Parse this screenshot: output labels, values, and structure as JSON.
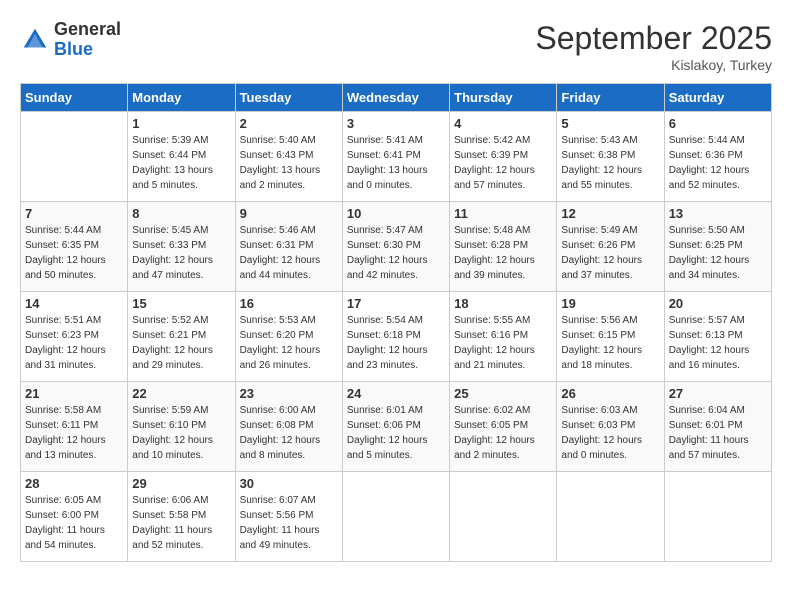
{
  "header": {
    "logo_general": "General",
    "logo_blue": "Blue",
    "title": "September 2025",
    "location": "Kislakoy, Turkey"
  },
  "days_of_week": [
    "Sunday",
    "Monday",
    "Tuesday",
    "Wednesday",
    "Thursday",
    "Friday",
    "Saturday"
  ],
  "weeks": [
    [
      {
        "day": "",
        "info": ""
      },
      {
        "day": "1",
        "info": "Sunrise: 5:39 AM\nSunset: 6:44 PM\nDaylight: 13 hours\nand 5 minutes."
      },
      {
        "day": "2",
        "info": "Sunrise: 5:40 AM\nSunset: 6:43 PM\nDaylight: 13 hours\nand 2 minutes."
      },
      {
        "day": "3",
        "info": "Sunrise: 5:41 AM\nSunset: 6:41 PM\nDaylight: 13 hours\nand 0 minutes."
      },
      {
        "day": "4",
        "info": "Sunrise: 5:42 AM\nSunset: 6:39 PM\nDaylight: 12 hours\nand 57 minutes."
      },
      {
        "day": "5",
        "info": "Sunrise: 5:43 AM\nSunset: 6:38 PM\nDaylight: 12 hours\nand 55 minutes."
      },
      {
        "day": "6",
        "info": "Sunrise: 5:44 AM\nSunset: 6:36 PM\nDaylight: 12 hours\nand 52 minutes."
      }
    ],
    [
      {
        "day": "7",
        "info": "Sunrise: 5:44 AM\nSunset: 6:35 PM\nDaylight: 12 hours\nand 50 minutes."
      },
      {
        "day": "8",
        "info": "Sunrise: 5:45 AM\nSunset: 6:33 PM\nDaylight: 12 hours\nand 47 minutes."
      },
      {
        "day": "9",
        "info": "Sunrise: 5:46 AM\nSunset: 6:31 PM\nDaylight: 12 hours\nand 44 minutes."
      },
      {
        "day": "10",
        "info": "Sunrise: 5:47 AM\nSunset: 6:30 PM\nDaylight: 12 hours\nand 42 minutes."
      },
      {
        "day": "11",
        "info": "Sunrise: 5:48 AM\nSunset: 6:28 PM\nDaylight: 12 hours\nand 39 minutes."
      },
      {
        "day": "12",
        "info": "Sunrise: 5:49 AM\nSunset: 6:26 PM\nDaylight: 12 hours\nand 37 minutes."
      },
      {
        "day": "13",
        "info": "Sunrise: 5:50 AM\nSunset: 6:25 PM\nDaylight: 12 hours\nand 34 minutes."
      }
    ],
    [
      {
        "day": "14",
        "info": "Sunrise: 5:51 AM\nSunset: 6:23 PM\nDaylight: 12 hours\nand 31 minutes."
      },
      {
        "day": "15",
        "info": "Sunrise: 5:52 AM\nSunset: 6:21 PM\nDaylight: 12 hours\nand 29 minutes."
      },
      {
        "day": "16",
        "info": "Sunrise: 5:53 AM\nSunset: 6:20 PM\nDaylight: 12 hours\nand 26 minutes."
      },
      {
        "day": "17",
        "info": "Sunrise: 5:54 AM\nSunset: 6:18 PM\nDaylight: 12 hours\nand 23 minutes."
      },
      {
        "day": "18",
        "info": "Sunrise: 5:55 AM\nSunset: 6:16 PM\nDaylight: 12 hours\nand 21 minutes."
      },
      {
        "day": "19",
        "info": "Sunrise: 5:56 AM\nSunset: 6:15 PM\nDaylight: 12 hours\nand 18 minutes."
      },
      {
        "day": "20",
        "info": "Sunrise: 5:57 AM\nSunset: 6:13 PM\nDaylight: 12 hours\nand 16 minutes."
      }
    ],
    [
      {
        "day": "21",
        "info": "Sunrise: 5:58 AM\nSunset: 6:11 PM\nDaylight: 12 hours\nand 13 minutes."
      },
      {
        "day": "22",
        "info": "Sunrise: 5:59 AM\nSunset: 6:10 PM\nDaylight: 12 hours\nand 10 minutes."
      },
      {
        "day": "23",
        "info": "Sunrise: 6:00 AM\nSunset: 6:08 PM\nDaylight: 12 hours\nand 8 minutes."
      },
      {
        "day": "24",
        "info": "Sunrise: 6:01 AM\nSunset: 6:06 PM\nDaylight: 12 hours\nand 5 minutes."
      },
      {
        "day": "25",
        "info": "Sunrise: 6:02 AM\nSunset: 6:05 PM\nDaylight: 12 hours\nand 2 minutes."
      },
      {
        "day": "26",
        "info": "Sunrise: 6:03 AM\nSunset: 6:03 PM\nDaylight: 12 hours\nand 0 minutes."
      },
      {
        "day": "27",
        "info": "Sunrise: 6:04 AM\nSunset: 6:01 PM\nDaylight: 11 hours\nand 57 minutes."
      }
    ],
    [
      {
        "day": "28",
        "info": "Sunrise: 6:05 AM\nSunset: 6:00 PM\nDaylight: 11 hours\nand 54 minutes."
      },
      {
        "day": "29",
        "info": "Sunrise: 6:06 AM\nSunset: 5:58 PM\nDaylight: 11 hours\nand 52 minutes."
      },
      {
        "day": "30",
        "info": "Sunrise: 6:07 AM\nSunset: 5:56 PM\nDaylight: 11 hours\nand 49 minutes."
      },
      {
        "day": "",
        "info": ""
      },
      {
        "day": "",
        "info": ""
      },
      {
        "day": "",
        "info": ""
      },
      {
        "day": "",
        "info": ""
      }
    ]
  ]
}
